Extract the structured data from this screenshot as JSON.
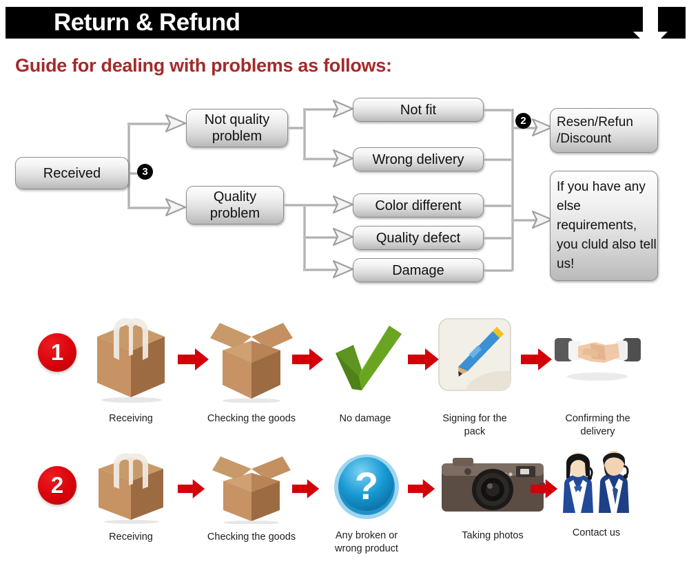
{
  "header": {
    "title": "Return & Refund",
    "arrow_icon": "down-arrow-icon"
  },
  "subtitle": "Guide for dealing with problems as follows:",
  "flowchart": {
    "badges": {
      "step3": "3",
      "step2": "2"
    },
    "nodes": {
      "received": "Received",
      "not_quality": "Not quality\nproblem",
      "quality": "Quality\nproblem",
      "not_fit": "Not fit",
      "wrong_delivery": "Wrong delivery",
      "color_different": "Color different",
      "quality_defect": "Quality defect",
      "damage": "Damage",
      "resend": "Resen/Refun\n/Discount",
      "contact_note": "If you have any else requirements, you cluld also tell us!"
    }
  },
  "process_rows": [
    {
      "number": "1",
      "steps": [
        {
          "label": "Receiving",
          "icon": "closed-box-icon"
        },
        {
          "label": "Checking the goods",
          "icon": "open-box-icon"
        },
        {
          "label": "No damage",
          "icon": "green-check-icon"
        },
        {
          "label": "Signing for the pack",
          "icon": "pencil-signing-icon"
        },
        {
          "label": "Confirming the delivery",
          "icon": "handshake-icon"
        }
      ]
    },
    {
      "number": "2",
      "steps": [
        {
          "label": "Receiving",
          "icon": "closed-box-icon"
        },
        {
          "label": "Checking the goods",
          "icon": "open-box-icon"
        },
        {
          "label": "Any broken or wrong product",
          "icon": "blue-question-icon"
        },
        {
          "label": "Taking photos",
          "icon": "camera-icon"
        },
        {
          "label": "Contact us",
          "icon": "customer-service-icon"
        }
      ]
    }
  ],
  "colors": {
    "header_bg": "#000000",
    "header_text": "#ffffff",
    "subtitle": "#a42a2a",
    "red_accent": "#d9030a",
    "box_border": "#8d8d8d",
    "connector": "#b8b8b8"
  }
}
